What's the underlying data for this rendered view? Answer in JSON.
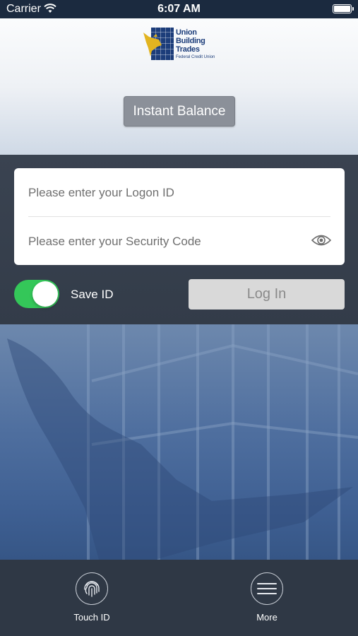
{
  "status_bar": {
    "carrier": "Carrier",
    "time": "6:07 AM"
  },
  "header": {
    "logo": {
      "line1": "Union",
      "line2": "Building",
      "line3": "Trades",
      "line4": "Federal Credit Union"
    },
    "instant_balance_label": "Instant Balance"
  },
  "login": {
    "logon_placeholder": "Please enter your Logon ID",
    "security_placeholder": "Please enter your Security Code",
    "save_id_label": "Save ID",
    "save_id_on": true,
    "login_label": "Log In"
  },
  "tabbar": {
    "touch_id_label": "Touch ID",
    "more_label": "More"
  },
  "colors": {
    "status_bar": "#1b2a3f",
    "toggle_on": "#34c759",
    "brand_blue": "#1c3d7a",
    "brand_gold": "#e2b420"
  },
  "icons": [
    "wifi-icon",
    "battery-icon",
    "eye-icon",
    "fingerprint-icon",
    "menu-icon"
  ]
}
